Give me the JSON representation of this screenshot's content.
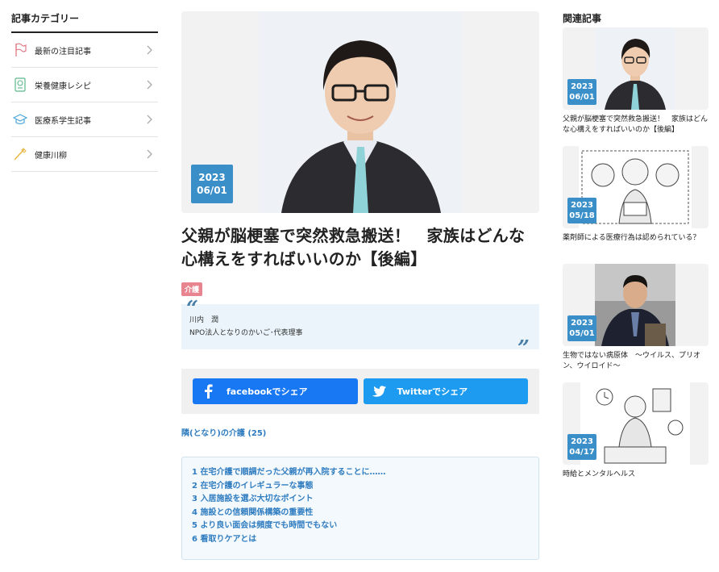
{
  "sidebar": {
    "title": "記事カテゴリー",
    "items": [
      {
        "label": "最新の注目記事",
        "icon": "flag-icon"
      },
      {
        "label": "栄養健康レシピ",
        "icon": "recipe-icon"
      },
      {
        "label": "医療系学生記事",
        "icon": "graduation-cap-icon"
      },
      {
        "label": "健康川柳",
        "icon": "brush-icon"
      }
    ]
  },
  "article": {
    "date_year": "2023",
    "date_md": "06/01",
    "title": "父親が脳梗塞で突然救急搬送！　家族はどんな心構えをすればいいのか【後編】",
    "tag": "介護",
    "author_name": "川内　潤",
    "author_role": "NPO法人となりのかいご･代表理事",
    "quote_open": "“",
    "quote_close": "”",
    "share_facebook": "facebookでシェア",
    "share_twitter": "Twitterでシェア",
    "series_link": "隣(となり)の介護 (25)",
    "toc": [
      "1 在宅介護で順調だった父親が再入院することに……",
      "2 在宅介護のイレギュラーな事態",
      "3 入居施設を選ぶ大切なポイント",
      "4 施設との信頼関係構築の重要性",
      "5 より良い面会は頻度でも時間でもない",
      "6 看取りケアとは"
    ]
  },
  "related": {
    "title": "関連記事",
    "items": [
      {
        "year": "2023",
        "md": "06/01",
        "title": "父親が脳梗塞で突然救急搬送！　家族はどんな心構えをすればいいのか【後編】"
      },
      {
        "year": "2023",
        "md": "05/18",
        "title": "薬剤師による医療行為は認められている？"
      },
      {
        "year": "2023",
        "md": "05/01",
        "title": "生物ではない病原体　～ウイルス、プリオン、ウイロイド～"
      },
      {
        "year": "2023",
        "md": "04/17",
        "title": "時給とメンタルヘルス"
      }
    ]
  },
  "colors": {
    "accent_blue": "#3a8fc9",
    "link_blue": "#2f7cc0",
    "tag_pink": "#e7848f",
    "facebook": "#1877f2",
    "twitter": "#1d9bf0"
  }
}
